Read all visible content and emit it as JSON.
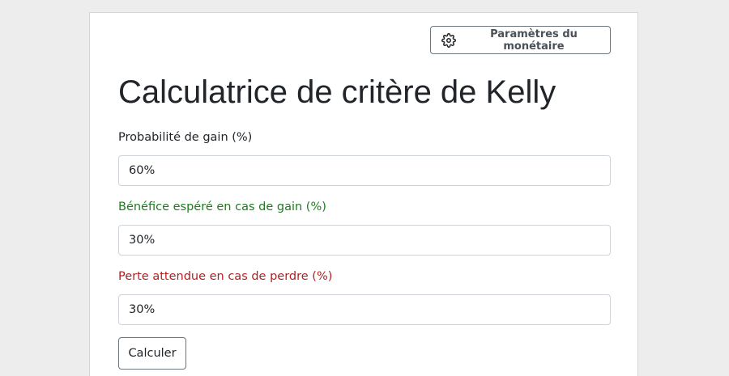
{
  "header": {
    "settings_button_label": "Paramètres du monétaire",
    "settings_icon": "gear-icon"
  },
  "form": {
    "title": "Calculatrice de critère de Kelly",
    "fields": [
      {
        "label": "Probabilité de gain (%)",
        "value": "60%",
        "label_color": "#212529"
      },
      {
        "label": "Bénéfice espéré en cas de gain (%)",
        "value": "30%",
        "label_color": "#1e7b1e"
      },
      {
        "label": "Perte attendue en cas de perdre (%)",
        "value": "30%",
        "label_color": "#b21f1f"
      }
    ],
    "submit_label": "Calculer"
  }
}
